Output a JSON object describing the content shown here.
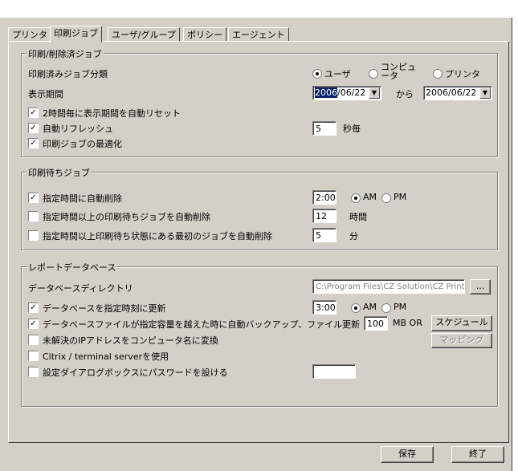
{
  "tabs": [
    "プリンタ",
    "印刷ジョブ",
    "ユーザ/グループ",
    "ポリシー",
    "エージェント"
  ],
  "printed_jobs": {
    "title": "印刷/削除済ジョブ",
    "classify_label": "印刷済みジョブ分類",
    "radio_user": "ユーザ",
    "radio_computer": "コンピュータ",
    "radio_printer": "プリンタ",
    "period_label": "表示期間",
    "from_date_selected": "2006",
    "from_date_rest": "/06/22",
    "from_label": "から",
    "to_date": "2006/06/22",
    "auto_reset_label": "2時間毎に表示期間を自動リセット",
    "auto_refresh_label": "自動リフレッシュ",
    "refresh_value": "5",
    "refresh_unit": "秒毎",
    "optimize_label": "印刷ジョブの最適化"
  },
  "waiting_jobs": {
    "title": "印刷待ちジョブ",
    "auto_delete_label": "指定時間に自動削除",
    "time_value": "2:00",
    "am_label": "AM",
    "pm_label": "PM",
    "delete_over_hours_label": "指定時間以上の印刷待ちジョブを自動削除",
    "hours_value": "12",
    "hours_unit": "時間",
    "delete_first_job_label": "指定時間以上印刷待ち状態にある最初のジョブを自動削除",
    "minutes_value": "5",
    "minutes_unit": "分"
  },
  "report_db": {
    "title": "レポートデータベース",
    "dir_label": "データベースディレクトリ",
    "dir_value": "C:\\Program Files\\CZ Solution\\CZ Print",
    "browse_label": "...",
    "update_label": "データベースを指定時刻に更新",
    "update_time": "3:00",
    "am_label": "AM",
    "pm_label": "PM",
    "backup_label": "データベースファイルが指定容量を越えた時に自動バックアップ、ファイル更新",
    "size_value": "100",
    "size_unit": "MB OR",
    "schedule_label": "スケジュール",
    "ip_label": "未解決のIPアドレスをコンピュータ名に変換",
    "mapping_label": "マッピング",
    "citrix_label": "Citrix / terminal serverを使用",
    "password_label": "設定ダイアログボックスにパスワードを設ける",
    "password_value": ""
  },
  "footer": {
    "save_label": "保存",
    "exit_label": "終了"
  }
}
